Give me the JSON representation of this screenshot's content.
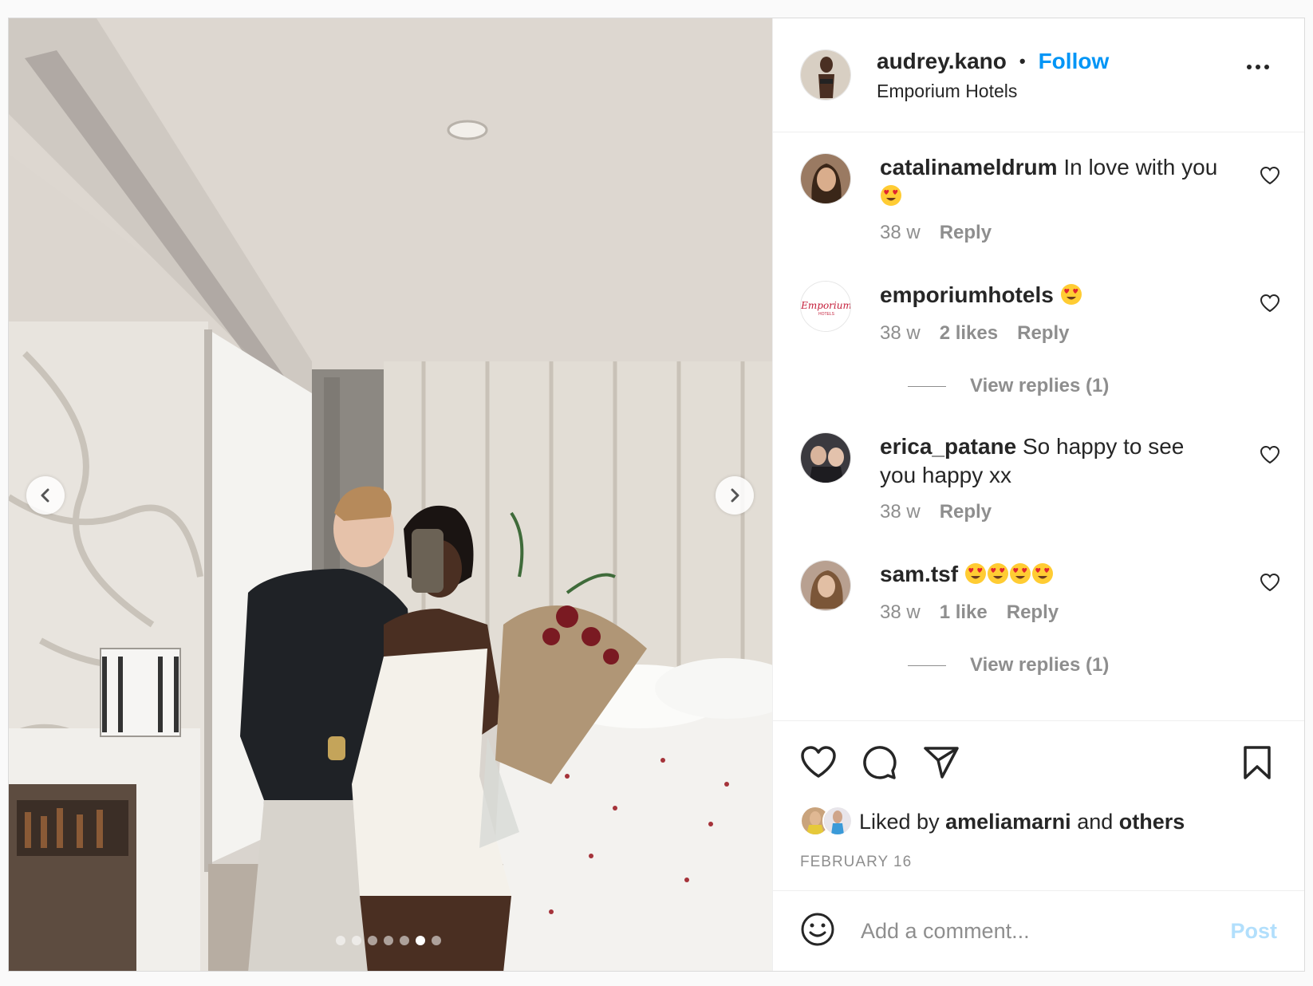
{
  "header": {
    "username": "audrey.kano",
    "separator": "•",
    "follow_label": "Follow",
    "location": "Emporium Hotels"
  },
  "comments": [
    {
      "username": "catalinameldrum",
      "text": "In love with you",
      "emoji_count": 1,
      "time": "38 w",
      "likes": "",
      "reply": "Reply",
      "view_replies": ""
    },
    {
      "username": "emporiumhotels",
      "text": "",
      "emoji_count": 1,
      "time": "38 w",
      "likes": "2 likes",
      "reply": "Reply",
      "view_replies": "View replies (1)"
    },
    {
      "username": "erica_patane",
      "text": "So happy to see you happy xx",
      "emoji_count": 0,
      "time": "38 w",
      "likes": "",
      "reply": "Reply",
      "view_replies": ""
    },
    {
      "username": "sam.tsf",
      "text": "",
      "emoji_count": 4,
      "time": "38 w",
      "likes": "1 like",
      "reply": "Reply",
      "view_replies": "View replies (1)"
    }
  ],
  "emporium_logo_text": "Emporium",
  "emporium_logo_sub": "HOTELS",
  "likes_line": {
    "prefix": "Liked by",
    "user": "ameliamarni",
    "and": "and",
    "others": "others"
  },
  "date": "FEBRUARY 16",
  "add_comment": {
    "placeholder": "Add a comment...",
    "post_label": "Post"
  },
  "carousel": {
    "total": 7,
    "active_index": 5
  },
  "colors": {
    "link_blue": "#0095f6",
    "post_disabled": "#b2dffc",
    "muted": "#8e8e8e",
    "text": "#262626"
  },
  "icons": [
    "chevron-left-icon",
    "chevron-right-icon",
    "more-icon",
    "heart-icon",
    "comment-icon",
    "share-icon",
    "bookmark-icon",
    "smiley-icon"
  ]
}
